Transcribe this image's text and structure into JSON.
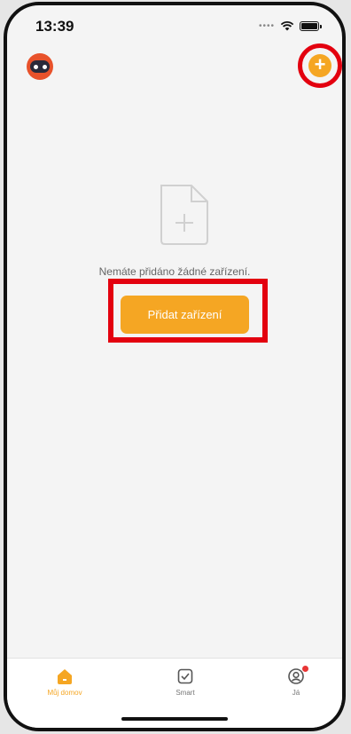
{
  "status_bar": {
    "time": "13:39",
    "icons": [
      "signal-dots-icon",
      "wifi-icon",
      "battery-icon"
    ]
  },
  "header": {
    "avatar_icon": "robot-avatar-icon",
    "add_icon": "plus-circle-icon"
  },
  "empty_state": {
    "icon": "add-file-icon",
    "message": "Nemáte přidáno žádné zařízení.",
    "button_label": "Přidat zařízení"
  },
  "tab_bar": {
    "items": [
      {
        "label": "Můj domov",
        "icon": "home-icon",
        "active": true
      },
      {
        "label": "Smart",
        "icon": "checkbox-icon",
        "active": false
      },
      {
        "label": "Já",
        "icon": "profile-icon",
        "active": false
      }
    ]
  },
  "colors": {
    "accent": "#f5a623",
    "highlight": "#e3000f",
    "badge": "#e83535"
  }
}
